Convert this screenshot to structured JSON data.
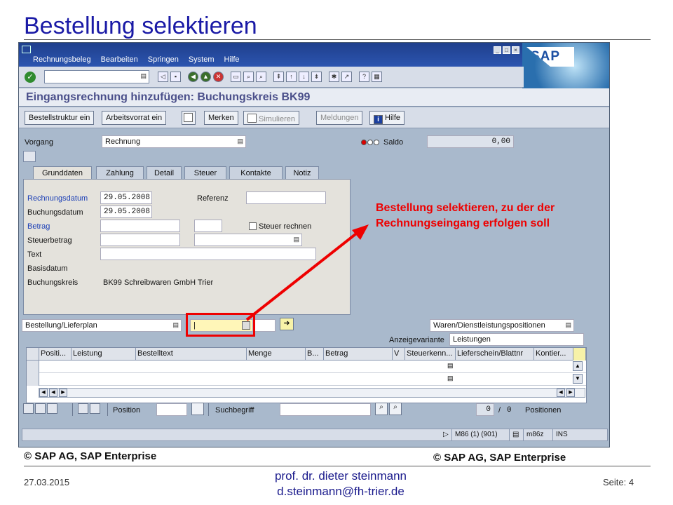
{
  "slide": {
    "title": "Bestellung selektieren",
    "copyright_left": "© SAP AG, SAP Enterprise",
    "copyright_right": "© SAP AG, SAP Enterprise",
    "date": "27.03.2015",
    "author_line1": "prof. dr. dieter steinmann",
    "author_line2": "d.steinmann@fh-trier.de",
    "page": "Seite: 4"
  },
  "annotation": {
    "text": "Bestellung selektieren, zu der der Rechnungseingang erfolgen soll",
    "color": "#e00000"
  },
  "sap": {
    "logo": "SAP",
    "menu": [
      "Rechnungsbeleg",
      "Bearbeiten",
      "Springen",
      "System",
      "Hilfe"
    ],
    "window_title": "Eingangsrechnung hinzufügen: Buchungskreis BK99",
    "app_toolbar": {
      "bestellstruktur": "Bestellstruktur ein",
      "arbeitsvorrat": "Arbeitsvorrat ein",
      "merken": "Merken",
      "simulieren": "Simulieren",
      "meldungen": "Meldungen",
      "hilfe": "Hilfe"
    },
    "header": {
      "vorgang_label": "Vorgang",
      "vorgang_value": "Rechnung",
      "saldo_label": "Saldo",
      "saldo_value": "0,00"
    },
    "tabs": [
      "Grunddaten",
      "Zahlung",
      "Detail",
      "Steuer",
      "Kontakte",
      "Notiz"
    ],
    "grunddaten": {
      "rechnungsdatum_label": "Rechnungsdatum",
      "rechnungsdatum_value": "29.05.2008",
      "buchungsdatum_label": "Buchungsdatum",
      "buchungsdatum_value": "29.05.2008",
      "referenz_label": "Referenz",
      "betrag_label": "Betrag",
      "steuer_rechnen_label": "Steuer rechnen",
      "steuerbetrag_label": "Steuerbetrag",
      "text_label": "Text",
      "basisdatum_label": "Basisdatum",
      "buchungskreis_label": "Buchungskreis",
      "buchungskreis_value": "BK99 Schreibwaren GmbH Trier"
    },
    "bestellung": {
      "type_value": "Bestellung/Lieferplan",
      "input_value": "|",
      "positionen_type": "Waren/Dienstleistungspositionen",
      "anzeigevariante_label": "Anzeigevariante",
      "anzeigevariante_value": "Leistungen"
    },
    "grid_columns": [
      "Positi...",
      "Leistung",
      "Bestelltext",
      "Menge",
      "B...",
      "Betrag",
      "V",
      "Steuerkenn...",
      "Lieferschein/Blattnr",
      "Kontier..."
    ],
    "bottom": {
      "position_label": "Position",
      "suchbegriff_label": "Suchbegriff",
      "count_value": "0",
      "slash": "/",
      "total_value": "0",
      "positionen_label": "Positionen"
    },
    "status": {
      "system": "M86 (1) (901)",
      "server": "m86z",
      "mode": "INS"
    }
  },
  "colors": {
    "title_blue": "#1a1aa6",
    "sap_background": "#a9b9cc",
    "highlight_red": "#e00000"
  }
}
